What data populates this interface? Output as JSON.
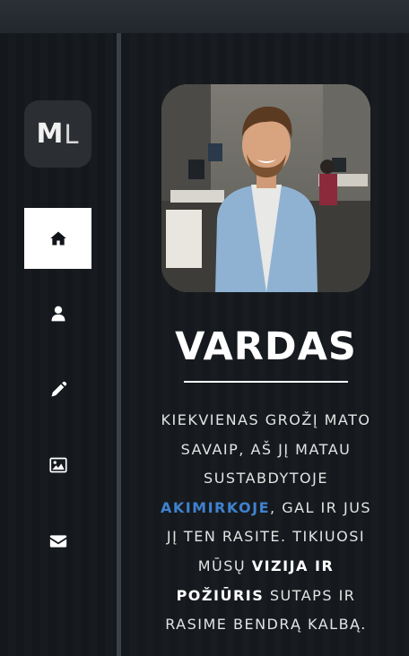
{
  "logo": {
    "letter1": "M",
    "letter2": "L"
  },
  "nav": [
    {
      "name": "home",
      "icon": "home-icon",
      "active": true
    },
    {
      "name": "about",
      "icon": "user-icon",
      "active": false
    },
    {
      "name": "edit",
      "icon": "pencil-icon",
      "active": false
    },
    {
      "name": "gallery",
      "icon": "image-icon",
      "active": false
    },
    {
      "name": "contact",
      "icon": "envelope-icon",
      "active": false
    }
  ],
  "profile": {
    "photo_alt": "profile-photo",
    "name": "VARDAS"
  },
  "bio": {
    "part1": "KIEKVIENAS GROŽĮ MATO SAVAIP, AŠ JĮ MATAU SUSTABDYTOJE ",
    "highlight": "AKIMIRKOJE",
    "part2": ", GAL IR JUS JĮ TEN RASITE. TIKIUOSI MŪSŲ ",
    "bold": "VIZIJA IR POŽIŪRIS",
    "part3": " SUTAPS IR RASIME BENDRĄ KALBĄ."
  },
  "colors": {
    "accent": "#3f82cf",
    "background": "#15191d",
    "active_nav": "#ffffff"
  }
}
